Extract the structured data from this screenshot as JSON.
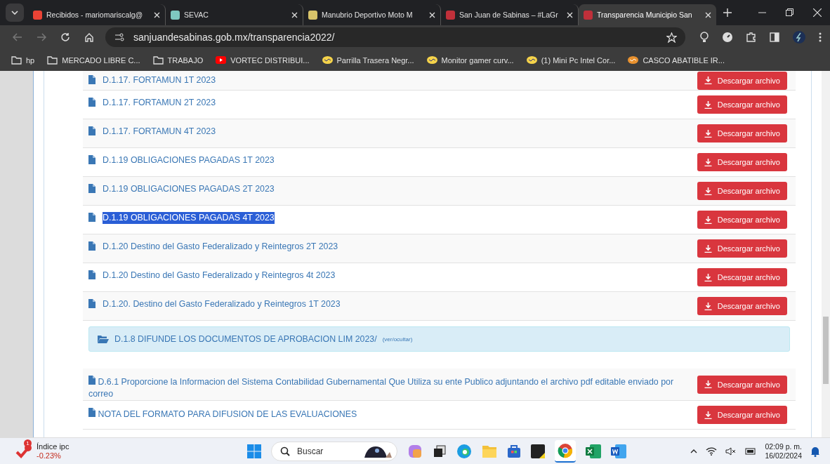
{
  "tabs": [
    {
      "title": "Recibidos - mariomariscalg@",
      "kind": "mail",
      "selected": false
    },
    {
      "title": "SEVAC",
      "kind": "map",
      "selected": false
    },
    {
      "title": "Manubrio Deportivo Moto M",
      "kind": "shop",
      "selected": false
    },
    {
      "title": "San Juan de Sabinas – #LaGr",
      "kind": "crest",
      "selected": false
    },
    {
      "title": "Transparencia Municipio San",
      "kind": "crest",
      "selected": true
    }
  ],
  "address": {
    "url": "sanjuandesabinas.gob.mx/transparencia2022/"
  },
  "bookmarks": [
    {
      "label": "hp",
      "kind": "folder"
    },
    {
      "label": "MERCADO LIBRE C...",
      "kind": "folder"
    },
    {
      "label": "TRABAJO",
      "kind": "folder"
    },
    {
      "label": "VORTEC DISTRIBUI...",
      "kind": "video"
    },
    {
      "label": "Parrilla Trasera Negr...",
      "kind": "shop"
    },
    {
      "label": "Monitor gamer curv...",
      "kind": "shop"
    },
    {
      "label": "(1) Mini Pc Intel Cor...",
      "kind": "shop"
    },
    {
      "label": "CASCO ABATIBLE IR...",
      "kind": "shop2"
    }
  ],
  "documents": [
    {
      "title": "D.1.17. FORTAMUN 1T 2023",
      "button": "Descargar archivo",
      "highlighted": false
    },
    {
      "title": "D.1.17. FORTAMUN 2T 2023",
      "button": "Descargar archivo",
      "highlighted": false
    },
    {
      "title": "D.1.17. FORTAMUN 4T 2023",
      "button": "Descargar archivo",
      "highlighted": false
    },
    {
      "title": "D.1.19 OBLIGACIONES PAGADAS 1T 2023",
      "button": "Descargar archivo",
      "highlighted": false
    },
    {
      "title": "D.1.19 OBLIGACIONES PAGADAS 2T 2023",
      "button": "Descargar archivo",
      "highlighted": false
    },
    {
      "title": "D.1.19 OBLIGACIONES PAGADAS 4T 2023",
      "button": "Descargar archivo",
      "highlighted": true
    },
    {
      "title": "D.1.20 Destino del Gasto Federalizado y Reintegros 2T 2023",
      "button": "Descargar archivo",
      "highlighted": false
    },
    {
      "title": "D.1.20 Destino del Gasto Federalizado y Reintegros 4t 2023",
      "button": "Descargar archivo",
      "highlighted": false
    },
    {
      "title": "D.1.20. Destino del Gasto Federalizado y Reintegros 1T 2023",
      "button": "Descargar archivo",
      "highlighted": false
    }
  ],
  "folder_panel": {
    "title": "D.1.8 DIFUNDE LOS DOCUMENTOS DE APROBACION LIM 2023/",
    "toggle": "(ver/ocultar)"
  },
  "documents_2": [
    {
      "title": "D.6.1 Proporcione la Informacion del Sistema Contabilidad Gubernamental Que Utiliza su ente Publico adjuntando el archivo pdf editable enviado por correo",
      "button": "Descargar archivo"
    },
    {
      "title": "NOTA DEL FORMATO PARA DIFUSION DE LAS EVALUACIONES",
      "button": "Descargar archivo"
    }
  ],
  "taskbar": {
    "widget_title": "Índice ipc",
    "widget_value": "-0.23%",
    "widget_badge": "1",
    "search_placeholder": "Buscar",
    "time": "02:09 p. m.",
    "date": "16/02/2024"
  }
}
